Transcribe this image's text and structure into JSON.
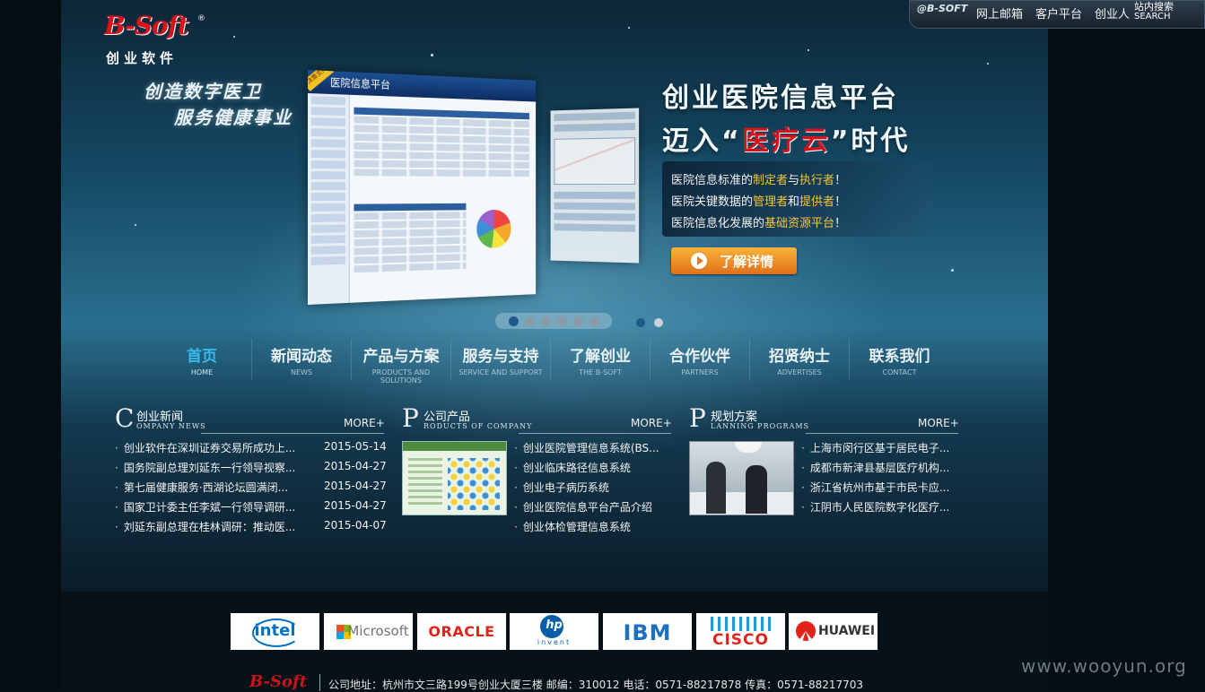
{
  "brand": {
    "logo_text": "B-Soft",
    "logo_cn": "创业软件",
    "registered": "®",
    "slogan_line1": "创造数字医卫",
    "slogan_line2": "服务健康事业"
  },
  "topbar": {
    "brand": "@B-SOFT",
    "links": [
      "网上邮箱",
      "客户平台",
      "创业人"
    ],
    "search_cn": "站内搜索",
    "search_en": "SEARCH"
  },
  "banner": {
    "screen_title": "医院信息平台",
    "screen_tag": "决策支持",
    "title_line1": "创业医院信息平台",
    "title_line2_prefix": "迈入“",
    "title_line2_highlight": "医疗云",
    "title_line2_suffix": "”时代",
    "bullets": [
      {
        "a": "医院信息标准的",
        "y1": "制定者",
        "b": "与",
        "y2": "执行者",
        "c": "！"
      },
      {
        "a": "医院关键数据的",
        "y1": "管理者",
        "b": "和",
        "y2": "提供者",
        "c": "！"
      },
      {
        "a": "医院信息化发展的",
        "y1": "基础资源平台",
        "b": "",
        "y2": "",
        "c": "！"
      }
    ],
    "more_label": "了解详情"
  },
  "nav": [
    {
      "cn": "首页",
      "en": "HOME",
      "active": true
    },
    {
      "cn": "新闻动态",
      "en": "NEWS"
    },
    {
      "cn": "产品与方案",
      "en": "PRODUCTS AND SOLUTIONS"
    },
    {
      "cn": "服务与支持",
      "en": "SERVICE AND SUPPORT"
    },
    {
      "cn": "了解创业",
      "en": "THE B-SOFT"
    },
    {
      "cn": "合作伙伴",
      "en": "PARTNERS"
    },
    {
      "cn": "招贤纳士",
      "en": "ADVERTISES"
    },
    {
      "cn": "联系我们",
      "en": "CONTACT"
    }
  ],
  "sections": {
    "news": {
      "big": "C",
      "cn": "创业新闻",
      "en": "OMPANY NEWS",
      "more": "MORE+",
      "items": [
        {
          "title": "创业软件在深圳证券交易所成功上...",
          "date": "2015-05-14"
        },
        {
          "title": "国务院副总理刘延东一行领导视察...",
          "date": "2015-04-27"
        },
        {
          "title": "第七届健康服务·西湖论坛圆满闭...",
          "date": "2015-04-27"
        },
        {
          "title": "国家卫计委主任李斌一行领导调研...",
          "date": "2015-04-27"
        },
        {
          "title": "刘延东副总理在桂林调研：推动医...",
          "date": "2015-04-07"
        }
      ]
    },
    "products": {
      "big": "P",
      "cn": "公司产品",
      "en": "RODUCTS OF COMPANY",
      "more": "MORE+",
      "items": [
        "创业医院管理信息系统(BS...",
        "创业临床路径信息系统",
        "创业电子病历系统",
        "创业医院信息平台产品介绍",
        "创业体检管理信息系统"
      ]
    },
    "plans": {
      "big": "P",
      "cn": "规划方案",
      "en": "LANNING PROGRAMS",
      "more": "MORE+",
      "items": [
        "上海市闵行区基于居民电子...",
        "成都市新津县基层医疗机构...",
        "浙江省杭州市基于市民卡应...",
        "江阴市人民医院数字化医疗..."
      ]
    }
  },
  "partners": {
    "intel": "intel",
    "microsoft": "Microsoft",
    "oracle": "ORACLE",
    "hp": "hp",
    "hp_sub": "invent",
    "ibm": "IBM",
    "cisco": "CISCO",
    "huawei": "HUAWEI"
  },
  "footer": {
    "logo": "B-Soft",
    "address": "公司地址：杭州市文三路199号创业大厦三楼 邮编：310012 电话：0571-88217878 传真：0571-88217703"
  },
  "watermark": "www.wooyun.org"
}
